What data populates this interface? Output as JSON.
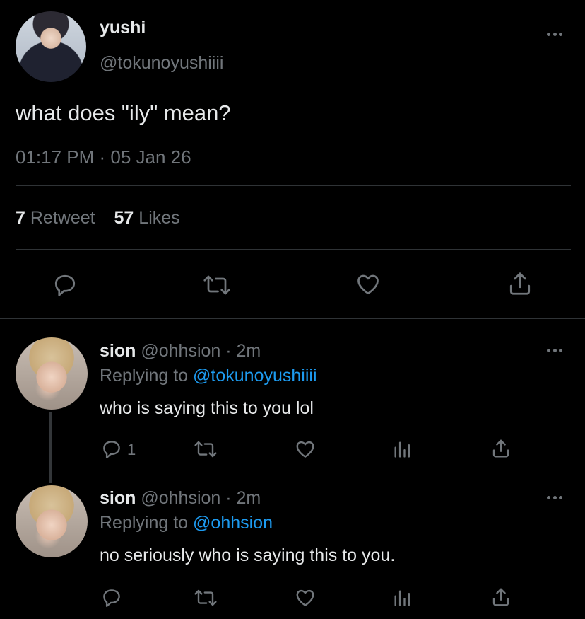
{
  "main_tweet": {
    "display_name": "yushi",
    "handle": "@tokunoyushiiii",
    "text": "what does \"ily\" mean?",
    "timestamp": "01:17 PM · 05 Jan 26",
    "retweet_count": "7",
    "retweet_label": "Retweet",
    "likes_count": "57",
    "likes_label": "Likes"
  },
  "replies": [
    {
      "display_name": "sion",
      "handle_time": "@ohhsion · 2m",
      "replying_prefix": "Replying to",
      "replying_to": "@tokunoyushiiii",
      "text": "who is saying this to you lol",
      "reply_count": "1"
    },
    {
      "display_name": "sion",
      "handle_time": "@ohhsion · 2m",
      "replying_prefix": "Replying to",
      "replying_to": "@ohhsion",
      "text": "no seriously who is saying this to you.",
      "reply_count": ""
    }
  ],
  "icons": {
    "reply": "reply-icon",
    "retweet": "retweet-icon",
    "like": "heart-icon",
    "analytics": "analytics-icon",
    "share": "share-icon",
    "more": "more-icon"
  },
  "colors": {
    "background": "#000000",
    "text": "#e7e9ea",
    "muted": "#71767b",
    "link": "#1d9bf0",
    "divider": "#2f3336"
  }
}
